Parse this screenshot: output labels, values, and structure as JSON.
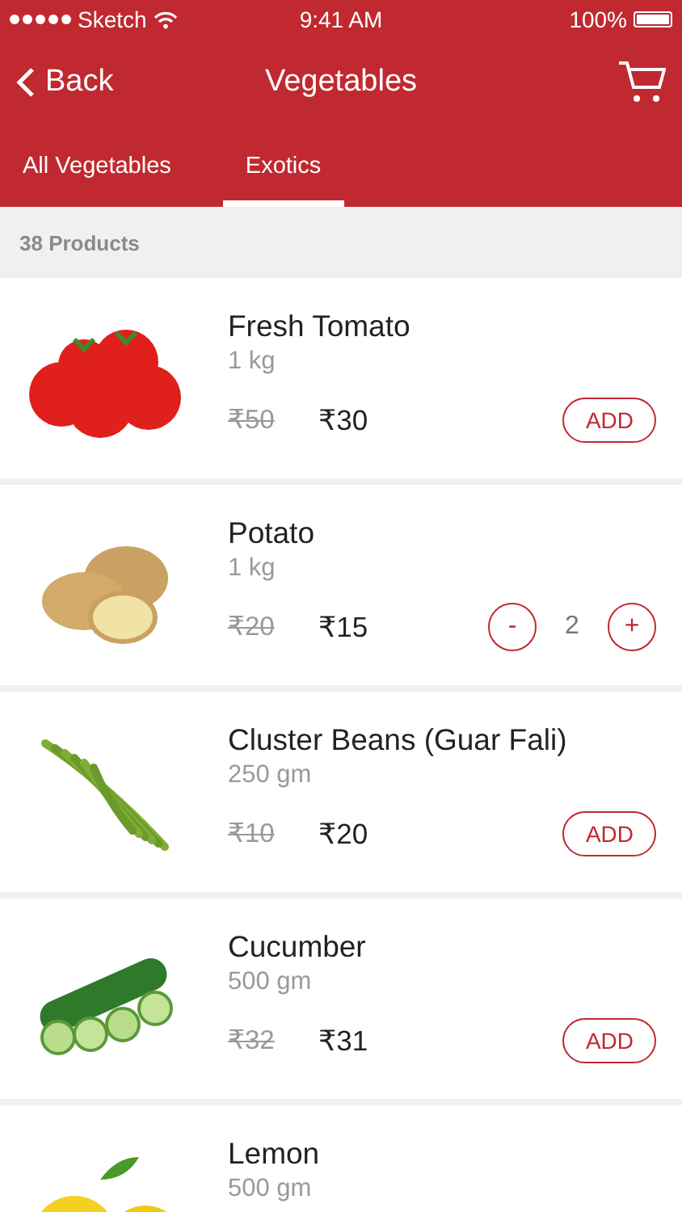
{
  "status_bar": {
    "carrier": "Sketch",
    "time": "9:41 AM",
    "battery": "100%"
  },
  "nav_bar": {
    "back": "Back",
    "title": "Vegetables"
  },
  "tabs": [
    {
      "label": "All Vegetables",
      "selected": false
    },
    {
      "label": "Exotics",
      "selected": true
    }
  ],
  "product_count": "38 Products",
  "products": [
    {
      "name": "Fresh Tomato",
      "weight": "1 kg",
      "old_price": "₹50",
      "price": "₹30",
      "control": {
        "kind": "add",
        "label": "ADD"
      }
    },
    {
      "name": "Potato",
      "weight": "1 kg",
      "old_price": "₹20",
      "price": "₹15",
      "control": {
        "kind": "stepper",
        "minus": "-",
        "quantity": "2",
        "plus": "+"
      }
    },
    {
      "name": "Cluster Beans (Guar Fali)",
      "weight": "250 gm",
      "old_price": "₹10",
      "price": "₹20",
      "control": {
        "kind": "add",
        "label": "ADD"
      }
    },
    {
      "name": "Cucumber",
      "weight": "500 gm",
      "old_price": "₹32",
      "price": "₹31",
      "control": {
        "kind": "add",
        "label": "ADD"
      }
    },
    {
      "name": "Lemon",
      "weight": "500 gm"
    }
  ]
}
